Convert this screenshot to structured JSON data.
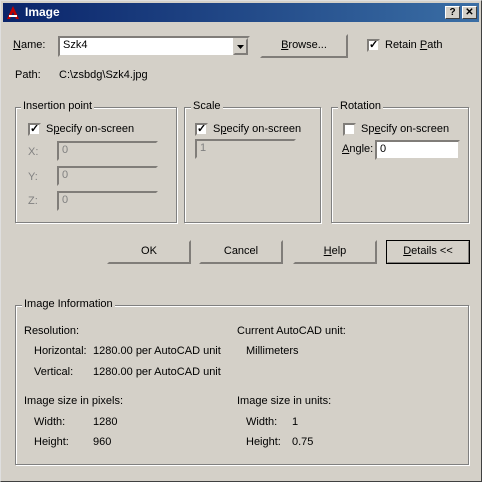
{
  "window": {
    "title": "Image",
    "help_glyph": "?",
    "close_glyph": "✕",
    "icon": "autocad-logo-icon"
  },
  "name_row": {
    "label": "Name:",
    "value": "Szk4",
    "browse_label": "Browse...",
    "retain_path_label": "Retain Path",
    "retain_path_checked": true
  },
  "path": {
    "label": "Path:",
    "value": "C:\\zsbdg\\Szk4.jpg"
  },
  "insertion_point": {
    "title": "Insertion point",
    "specify_label": "Specify on-screen",
    "checked": true,
    "x_label": "X:",
    "x_value": "0",
    "y_label": "Y:",
    "y_value": "0",
    "z_label": "Z:",
    "z_value": "0"
  },
  "scale": {
    "title": "Scale",
    "specify_label": "Specify on-screen",
    "checked": true,
    "value": "1"
  },
  "rotation": {
    "title": "Rotation",
    "specify_label": "Specify on-screen",
    "checked": false,
    "angle_label": "Angle:",
    "angle_value": "0"
  },
  "buttons": {
    "ok": "OK",
    "cancel": "Cancel",
    "help": "Help",
    "details": "Details <<"
  },
  "image_info": {
    "title": "Image Information",
    "resolution_label": "Resolution:",
    "horizontal_label": "Horizontal:",
    "horizontal_value": "1280.00 per AutoCAD unit",
    "vertical_label": "Vertical:",
    "vertical_value": "1280.00 per AutoCAD unit",
    "current_unit_label": "Current AutoCAD unit:",
    "current_unit_value": "Millimeters",
    "pixels_label": "Image size in pixels:",
    "px_width_label": "Width:",
    "px_width_value": "1280",
    "px_height_label": "Height:",
    "px_height_value": "960",
    "units_label": "Image size in units:",
    "u_width_label": "Width:",
    "u_width_value": "1",
    "u_height_label": "Height:",
    "u_height_value": "0.75"
  },
  "colors": {
    "face": "#d4d0c8",
    "title_start": "#0a246a",
    "title_end": "#3a6ea5"
  }
}
